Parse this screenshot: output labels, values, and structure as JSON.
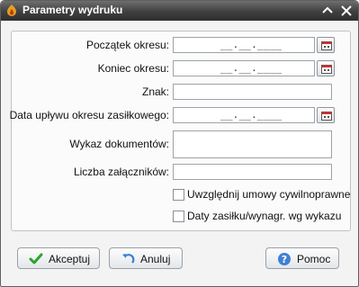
{
  "window": {
    "title": "Parametry wydruku",
    "icons": {
      "app": "app-logo-icon",
      "minimize": "chevron-up-icon",
      "close": "close-icon"
    }
  },
  "form": {
    "start_label": "Początek okresu:",
    "start_value": "__.__.____",
    "end_label": "Koniec okresu:",
    "end_value": "__.__.____",
    "sign_label": "Znak:",
    "sign_value": "",
    "expiry_label": "Data upływu okresu zasiłkowego:",
    "expiry_value": "__.__.____",
    "docs_label": "Wykaz dokumentów:",
    "docs_value": "",
    "attachments_label": "Liczba załączników:",
    "attachments_value": "",
    "check_civil_label": "Uwzględnij umowy cywilnoprawne",
    "check_civil_checked": false,
    "check_dates_label": "Daty zasiłku/wynagr. wg wykazu",
    "check_dates_checked": false
  },
  "buttons": {
    "accept_label": "Akceptuj",
    "cancel_label": "Anuluj",
    "help_label": "Pomoc"
  },
  "colors": {
    "titlebar": "#3f3f3f",
    "accept_icon": "#2aa52a",
    "help_icon": "#3f7fd6"
  }
}
